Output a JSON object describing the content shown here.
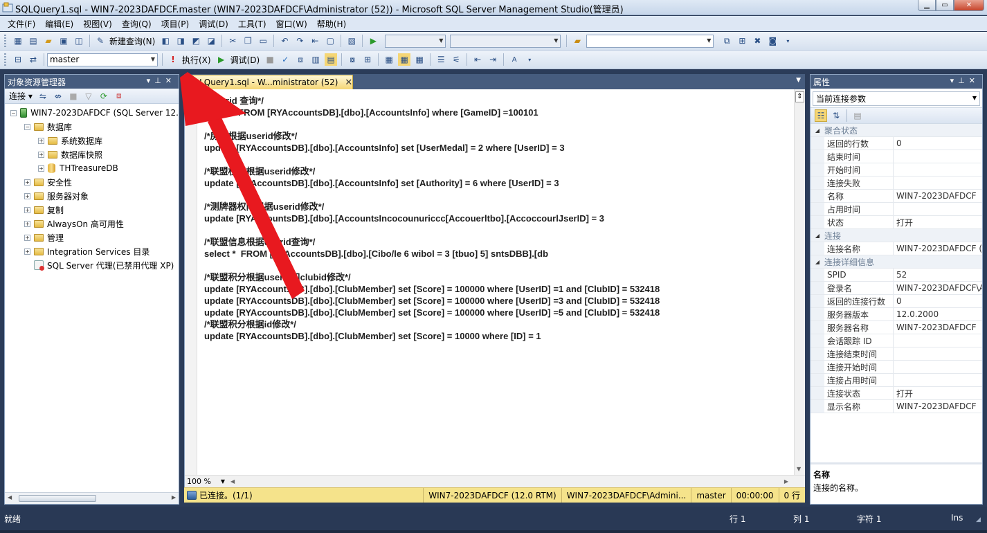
{
  "window": {
    "title": "SQLQuery1.sql - WIN7-2023DAFDCF.master (WIN7-2023DAFDCF\\Administrator (52)) - Microsoft SQL Server Management Studio(管理员)"
  },
  "menu": [
    "文件(F)",
    "编辑(E)",
    "视图(V)",
    "查询(Q)",
    "项目(P)",
    "调试(D)",
    "工具(T)",
    "窗口(W)",
    "帮助(H)"
  ],
  "toolbar1": {
    "new_query": "新建查询(N)"
  },
  "toolbar2": {
    "database": "master",
    "execute": "执行(X)",
    "debug": "调试(D)"
  },
  "object_explorer": {
    "title": "对象资源管理器",
    "connect": "连接",
    "tree": [
      {
        "label": "WIN7-2023DAFDCF (SQL Server 12.",
        "level": 0,
        "icon": "server"
      },
      {
        "label": "数据库",
        "level": 1,
        "icon": "folder"
      },
      {
        "label": "系统数据库",
        "level": 2,
        "icon": "folder"
      },
      {
        "label": "数据库快照",
        "level": 2,
        "icon": "folder"
      },
      {
        "label": "THTreasureDB",
        "level": 2,
        "icon": "db"
      },
      {
        "label": "安全性",
        "level": 1,
        "icon": "folder"
      },
      {
        "label": "服务器对象",
        "level": 1,
        "icon": "folder"
      },
      {
        "label": "复制",
        "level": 1,
        "icon": "folder"
      },
      {
        "label": "AlwaysOn 高可用性",
        "level": 1,
        "icon": "folder"
      },
      {
        "label": "管理",
        "level": 1,
        "icon": "folder"
      },
      {
        "label": "Integration Services 目录",
        "level": 1,
        "icon": "folder"
      },
      {
        "label": "SQL Server 代理(已禁用代理 XP)",
        "level": 1,
        "icon": "agent"
      }
    ]
  },
  "editor": {
    "tab_label": "SQLQuery1.sql - W...ministrator (52)",
    "code_lines": [
      "/*userid 查询*/",
      "select * FROM [RYAccountsDB].[dbo].[AccountsInfo] where [GameID] =100101",
      "",
      "/*房卡根据userid修改*/",
      "update [RYAccountsDB].[dbo].[AccountsInfo] set [UserMedal] = 2 where [UserID] = 3",
      "",
      "/*联盟权限根据userid修改*/",
      "update [RYAccountsDB].[dbo].[AccountsInfo] set [Authority] = 6 where [UserID] = 3",
      "",
      "/*测牌器权限根据userid修改*/",
      "update [RYAccountsDB].[dbo].[AccountsIncocounuriccc[Accouerltbo].[AccoccourlJserID] = 3",
      "",
      "/*联盟信息根据userid查询*/",
      "select *  FROM [RYAccountsDB].[dbo].[Cibo/le 6 wibol = 3 [tbuo] 5] sntsDBB].[db",
      "",
      "/*联盟积分根据userid和clubid修改*/",
      "update [RYAccountsDB].[dbo].[ClubMember] set [Score] = 100000 where [UserID] =1 and [ClubID] = 532418",
      "update [RYAccountsDB].[dbo].[ClubMember] set [Score] = 100000 where [UserID] =3 and [ClubID] = 532418",
      "update [RYAccountsDB].[dbo].[ClubMember] set [Score] = 100000 where [UserID] =5 and [ClubID] = 532418",
      "/*联盟积分根据id修改*/",
      "update [RYAccountsDB].[dbo].[ClubMember] set [Score] = 10000 where [ID] = 1"
    ],
    "zoom": "100 %"
  },
  "query_status": {
    "connected": "已连接。(1/1)",
    "server": "WIN7-2023DAFDCF (12.0 RTM)",
    "user": "WIN7-2023DAFDCF\\Admini...",
    "database": "master",
    "elapsed": "00:00:00",
    "rows": "0 行"
  },
  "properties": {
    "title": "属性",
    "selector": "当前连接参数",
    "rows": [
      {
        "type": "cat",
        "name": "聚合状态"
      },
      {
        "type": "prop",
        "name": "返回的行数",
        "value": "0"
      },
      {
        "type": "prop",
        "name": "结束时间",
        "value": ""
      },
      {
        "type": "prop",
        "name": "开始时间",
        "value": ""
      },
      {
        "type": "prop",
        "name": "连接失败",
        "value": ""
      },
      {
        "type": "prop",
        "name": "名称",
        "value": "WIN7-2023DAFDCF"
      },
      {
        "type": "prop",
        "name": "占用时间",
        "value": ""
      },
      {
        "type": "prop",
        "name": "状态",
        "value": "打开"
      },
      {
        "type": "cat",
        "name": "连接"
      },
      {
        "type": "prop",
        "name": "连接名称",
        "value": "WIN7-2023DAFDCF (W"
      },
      {
        "type": "cat",
        "name": "连接详细信息"
      },
      {
        "type": "prop",
        "name": "SPID",
        "value": "52"
      },
      {
        "type": "prop",
        "name": "登录名",
        "value": "WIN7-2023DAFDCF\\A"
      },
      {
        "type": "prop",
        "name": "返回的连接行数",
        "value": "0"
      },
      {
        "type": "prop",
        "name": "服务器版本",
        "value": "12.0.2000"
      },
      {
        "type": "prop",
        "name": "服务器名称",
        "value": "WIN7-2023DAFDCF"
      },
      {
        "type": "prop",
        "name": "会话跟踪 ID",
        "value": ""
      },
      {
        "type": "prop",
        "name": "连接结束时间",
        "value": ""
      },
      {
        "type": "prop",
        "name": "连接开始时间",
        "value": ""
      },
      {
        "type": "prop",
        "name": "连接占用时间",
        "value": ""
      },
      {
        "type": "prop",
        "name": "连接状态",
        "value": "打开"
      },
      {
        "type": "prop",
        "name": "显示名称",
        "value": "WIN7-2023DAFDCF"
      }
    ],
    "desc_name": "名称",
    "desc_text": "连接的名称。"
  },
  "statusbar": {
    "ready": "就绪",
    "line": "行 1",
    "col": "列 1",
    "char": "字符 1",
    "mode": "Ins"
  },
  "colors": {
    "annotation_arrow": "#e8191f",
    "status_yellow": "#f5e38b",
    "panel_header": "#465c7e"
  }
}
